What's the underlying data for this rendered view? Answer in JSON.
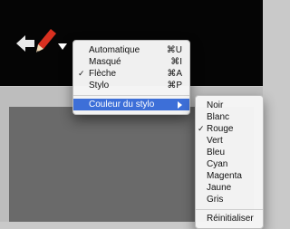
{
  "toolbar": {
    "back_icon": "back-arrow-icon",
    "pen_icon": "pen-icon",
    "dropdown_icon": "chevron-down-icon"
  },
  "main_menu": {
    "items": [
      {
        "label": "Automatique",
        "shortcut": "⌘U",
        "checked": false
      },
      {
        "label": "Masqué",
        "shortcut": "⌘I",
        "checked": false
      },
      {
        "label": "Flèche",
        "shortcut": "⌘A",
        "checked": true
      },
      {
        "label": "Stylo",
        "shortcut": "⌘P",
        "checked": false
      }
    ],
    "submenu_label": "Couleur du stylo",
    "check_mark": "✓"
  },
  "color_menu": {
    "items": [
      {
        "label": "Noir",
        "checked": false
      },
      {
        "label": "Blanc",
        "checked": false
      },
      {
        "label": "Rouge",
        "checked": true
      },
      {
        "label": "Vert",
        "checked": false
      },
      {
        "label": "Bleu",
        "checked": false
      },
      {
        "label": "Cyan",
        "checked": false
      },
      {
        "label": "Magenta",
        "checked": false
      },
      {
        "label": "Jaune",
        "checked": false
      },
      {
        "label": "Gris",
        "checked": false
      }
    ],
    "reset_label": "Réinitialiser",
    "check_mark": "✓"
  },
  "colors": {
    "highlight": "#3d6fd8",
    "pen_red": "#d8301f",
    "toolbar_bg": "#050505"
  }
}
